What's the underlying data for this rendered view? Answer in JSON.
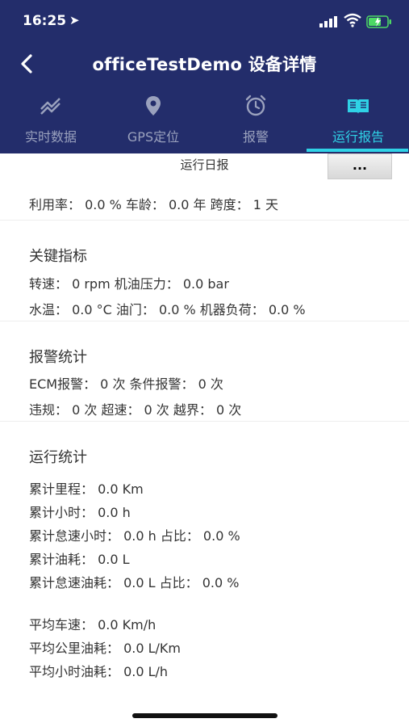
{
  "status_bar": {
    "time": "16:25"
  },
  "nav": {
    "title": "officeTestDemo 设备详情"
  },
  "tabs": [
    {
      "label": "实时数据",
      "icon": "line-chart-icon"
    },
    {
      "label": "GPS定位",
      "icon": "location-pin-icon"
    },
    {
      "label": "报警",
      "icon": "alarm-clock-icon"
    },
    {
      "label": "运行报告",
      "icon": "book-icon"
    }
  ],
  "report": {
    "title": "运行日报",
    "more_label": "..."
  },
  "lines": {
    "summary": "利用率： 0.0 %  车龄： 0.0 年  跨度： 1 天",
    "key_title": "关键指标",
    "key_1": "转速：  0 rpm  机油压力：  0.0 bar",
    "key_2": "水温：  0.0 °C  油门：  0.0 %  机器负荷：  0.0 %",
    "alarm_title": "报警统计",
    "alarm_1": "ECM报警：  0 次  条件报警：  0 次",
    "alarm_2": "违规：  0 次  超速：  0 次  越界：  0 次",
    "run_title": "运行统计",
    "run_1": "累计里程：  0.0 Km",
    "run_2": "累计小时：  0.0 h",
    "run_3": "累计怠速小时：  0.0 h  占比：  0.0 %",
    "run_4": "累计油耗：  0.0 L",
    "run_5": "累计怠速油耗：  0.0 L  占比：  0.0 %",
    "avg_1": "平均车速：  0.0 Km/h",
    "avg_2": "平均公里油耗：  0.0 L/Km",
    "avg_3": "平均小时油耗：  0.0 L/h"
  },
  "colors": {
    "header_bg": "#232d6b",
    "active_tab": "#2fd2e6",
    "inactive_tab": "#9aa1bd"
  }
}
